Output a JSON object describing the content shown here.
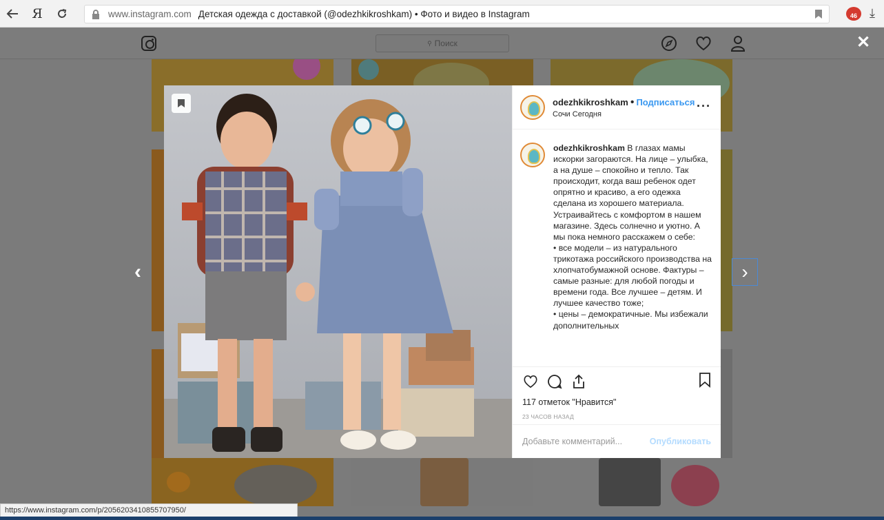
{
  "browser": {
    "back_icon": "arrow-left-icon",
    "yandex_label": "Я",
    "reload_icon": "reload-icon",
    "domain": "www.instagram.com",
    "page_title": "Детская одежда с доставкой (@odezhkikroshkam) • Фото и видео в Instagram",
    "extension_badge": "46"
  },
  "header": {
    "search_placeholder": "Поиск"
  },
  "post": {
    "username": "odezhkikroshkam",
    "follow_label": "Подписаться",
    "location": "Сочи Сегодня",
    "caption_username": "odezhkikroshkam",
    "caption": " В глазах мамы искорки загораются. На лице – улыбка, а на душе – спокойно и тепло. Так происходит, когда ваш ребенок одет опрятно и красиво, а его одежка сделана из хорошего материала.\nУстраивайтесь с комфортом в нашем магазине. Здесь солнечно и уютно. А мы пока немного расскажем о себе:\n• все модели – из натурального трикотажа российского производства на хлопчатобумажной основе. Фактуры – самые разные: для любой погоды и времени года. Все лучшее – детям. И лучшее качество тоже;\n• цены – демократичные. Мы избежали дополнительных",
    "likes": "117 отметок \"Нравится\"",
    "time": "23 ЧАСОВ НАЗАД",
    "comment_placeholder": "Добавьте комментарий...",
    "publish_label": "Опубликовать"
  },
  "status_url": "https://www.instagram.com/p/2056203410855707950/"
}
